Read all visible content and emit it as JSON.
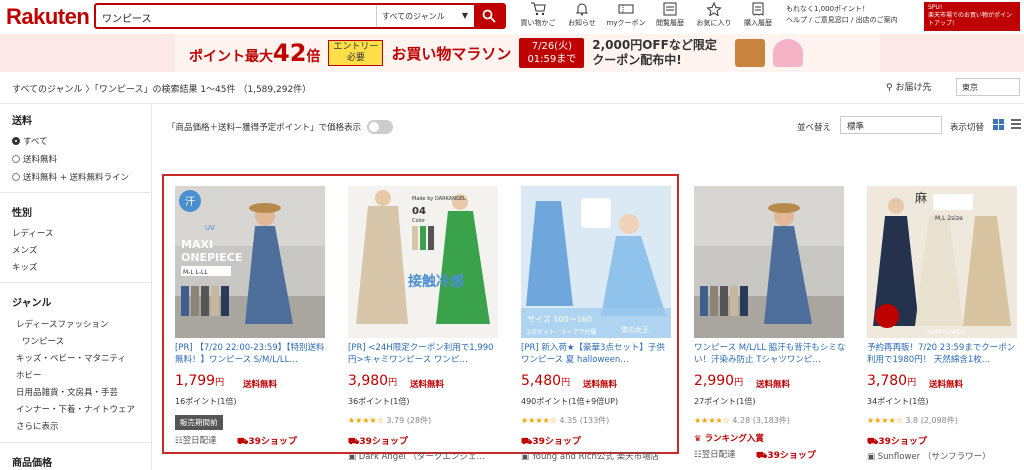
{
  "header": {
    "logo": "Rakuten",
    "search_value": "ワンピース",
    "genre": "すべてのジャンル",
    "icons": [
      {
        "name": "cart-icon",
        "label": "買い物かご"
      },
      {
        "name": "bell-icon",
        "label": "お知らせ"
      },
      {
        "name": "coupon-icon",
        "label": "myクーポン"
      },
      {
        "name": "history-icon",
        "label": "閲覧履歴"
      },
      {
        "name": "star-icon",
        "label": "お気に入り"
      },
      {
        "name": "receipt-icon",
        "label": "購入履歴"
      }
    ],
    "promo_line": "もれなく1,000ポイント！",
    "links": "ヘルプ / ご意見窓口 / 出店のご案内",
    "spu_label": "SPU!",
    "spu_text": "楽天市場でのお買い物がポイントアップ!"
  },
  "banner": {
    "p1": "ポイント最大",
    "p1_num": "42",
    "p1_suffix": "倍",
    "entry_line1": "エントリー",
    "entry_line2": "必要",
    "title": "お買い物マラソン",
    "date_line1": "7/26(火)",
    "date_line2": "01:59まで",
    "offer_line1": "2,000円OFFなど限定",
    "offer_line2": "クーポン配布中!"
  },
  "breadcrumb": "すべてのジャンル 〉「ワンピース」の検索結果 1〜45件 （1,589,292件）",
  "delivery": {
    "label": "お届け先",
    "value": "東京"
  },
  "sidebar": {
    "shipping_title": "送料",
    "shipping_options": [
      "すべて",
      "送料無料",
      "送料無料 + 送料無料ライン"
    ],
    "gender_title": "性別",
    "gender_items": [
      "レディース",
      "メンズ",
      "キッズ"
    ],
    "genre_title": "ジャンル",
    "genre_items": [
      "レディースファッション",
      "ワンピース",
      "キッズ・ベビー・マタニティ",
      "ホビー",
      "日用品雑貨・文房具・手芸",
      "インナー・下着・ナイトウェア",
      "さらに表示"
    ],
    "price_title": "商品価格"
  },
  "toolbar": {
    "toggle_label": "「商品価格＋送料−獲得予定ポイント」で価格表示",
    "sort_label": "並べ替え",
    "sort_value": "標準",
    "display_label": "表示切替"
  },
  "products": [
    {
      "title": "[PR] 【7/20 22:00-23:59】【特別送料無料！】ワンピース S/M/L/LL…",
      "price": "1,799",
      "ship": "送料無料",
      "points": "16ポイント(1倍)",
      "badge": "販売期間前",
      "fast": "翌日配達",
      "shop39": "39ショップ",
      "shop": ""
    },
    {
      "title": "[PR] <24H限定クーポン利用で1,990円>キャミワンピース ワンピ…",
      "price": "3,980",
      "ship": "送料無料",
      "points": "36ポイント(1倍)",
      "rating": "3.79",
      "reviews": "(28件)",
      "shop39": "39ショップ",
      "shop": "Dark Angel （ダークエンジェ…"
    },
    {
      "title": "[PR] 新入荷★【豪華3点セット】子供 ワンピース 夏 halloween…",
      "price": "5,480",
      "ship": "送料無料",
      "points": "490ポイント(1倍+9倍UP)",
      "rating": "4.35",
      "reviews": "(133件)",
      "shop39": "39ショップ",
      "shop": "Young and Rich公式 楽天市場店"
    },
    {
      "title": "ワンピース M/L/LL 脇汗も背汗もシミない！汗染み防止 Tシャツワンピ…",
      "price": "2,990",
      "ship": "送料無料",
      "points": "27ポイント(1倍)",
      "rating": "4.28",
      "reviews": "(3,183件)",
      "rank": "ランキング入賞",
      "fast": "翌日配達",
      "shop39": "39ショップ",
      "shop": ""
    },
    {
      "title": "予約再再販！7/20 23:59までクーポン利用で1980円！ 天然綿含1枚…",
      "price": "3,780",
      "ship": "送料無料",
      "points": "34ポイント(1倍)",
      "rating": "3.8",
      "reviews": "(2,098件)",
      "shop39": "39ショップ",
      "shop": "Sunflower （サンフラワー）"
    }
  ],
  "image_text": {
    "p1_badge": "汗",
    "p1_uy": "UV",
    "p1_heading1": "MAXI",
    "p1_heading2": "ONEPIECE",
    "p1_sizes": "M-L  L-LL",
    "p2_brand": "Made by DARKANGEL",
    "p2_count": "04",
    "p2_color": "Color",
    "p2_feature": "接触冷感",
    "p3_size": "サイズ 100〜160",
    "p3_set": "2点セット・ティアラ付属",
    "p3_tag": "雪の女王",
    "p5_kanji": "麻",
    "p5_sizes": "M,L 2size",
    "p5_brand": "SUNFLOWER"
  },
  "colors": {
    "brand": "#bf0000",
    "link": "#2a6bb5",
    "highlight_box": "#c92a2a"
  }
}
